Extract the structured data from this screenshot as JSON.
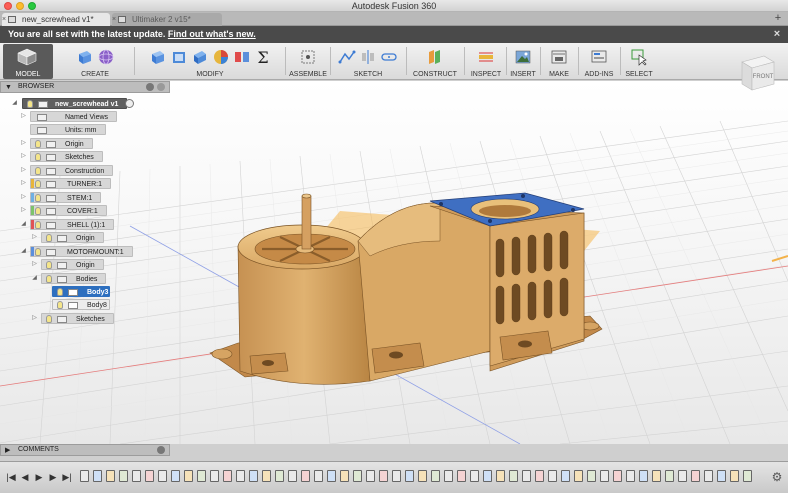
{
  "window": {
    "title": "Autodesk Fusion 360"
  },
  "tabs": [
    {
      "label": "new_screwhead v1*",
      "active": true
    },
    {
      "label": "Ultimaker 2 v15*",
      "active": false
    }
  ],
  "banner": {
    "message": "You are all set with the latest update.",
    "link": "Find out what's new."
  },
  "toolbar": {
    "workspace": "MODEL",
    "groups": [
      "CREATE",
      "MODIFY",
      "ASSEMBLE",
      "SKETCH",
      "CONSTRUCT",
      "INSPECT",
      "INSERT",
      "MAKE",
      "ADD-INS",
      "SELECT"
    ]
  },
  "viewcube": {
    "face": "FRONT"
  },
  "browser": {
    "title": "BROWSER",
    "root": "new_screwhead v1",
    "items": [
      {
        "label": "Named Views"
      },
      {
        "label": "Units: mm"
      },
      {
        "label": "Origin"
      },
      {
        "label": "Sketches"
      },
      {
        "label": "Construction"
      },
      {
        "label": "TURNER:1"
      },
      {
        "label": "STEM:1"
      },
      {
        "label": "COVER:1"
      },
      {
        "label": "SHELL (1):1"
      },
      {
        "label": "Origin"
      },
      {
        "label": "MOTORMOUNT:1"
      },
      {
        "label": "Origin"
      },
      {
        "label": "Bodies"
      },
      {
        "label": "Body3"
      },
      {
        "label": "Body8"
      },
      {
        "label": "Sketches"
      }
    ]
  },
  "comments": {
    "title": "COMMENTS"
  },
  "colors": {
    "banner_bg": "#4a4a4a",
    "selection": "#2d6fbf",
    "model_wood": "#d9a865",
    "cover_blue": "#3f6fc2",
    "plane_orange": "#f3b24a"
  },
  "icons": {
    "workspace": "model-cube-icon",
    "timeline_controls": [
      "go-to-start-icon",
      "step-back-icon",
      "play-icon",
      "step-forward-icon",
      "go-to-end-icon"
    ],
    "settings": "gear-icon"
  }
}
